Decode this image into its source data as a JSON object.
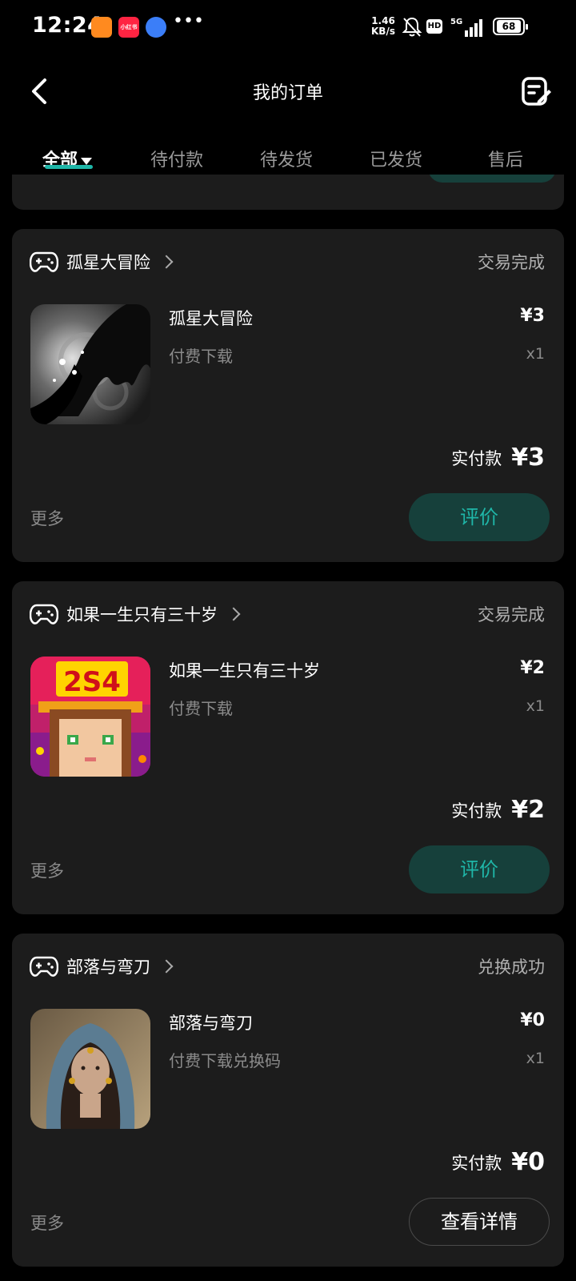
{
  "status_bar": {
    "time": "12:24",
    "app_badge": "小红书",
    "net_speed_value": "1.46",
    "net_speed_unit": "KB/s",
    "hd": "HD",
    "network": "5G",
    "battery": "68"
  },
  "header": {
    "title": "我的订单"
  },
  "tabs": [
    {
      "label": "全部"
    },
    {
      "label": "待付款"
    },
    {
      "label": "待发货"
    },
    {
      "label": "已发货"
    },
    {
      "label": "售后"
    }
  ],
  "orders": [
    {
      "store": "孤星大冒险",
      "status": "交易完成",
      "item_name": "孤星大冒险",
      "item_type": "付费下载",
      "price": "¥3",
      "qty": "x1",
      "paid_label": "实付款",
      "paid_amount": "¥3",
      "more": "更多",
      "action": "评价"
    },
    {
      "store": "如果一生只有三十岁",
      "status": "交易完成",
      "item_name": "如果一生只有三十岁",
      "item_type": "付费下载",
      "price": "¥2",
      "qty": "x1",
      "paid_label": "实付款",
      "paid_amount": "¥2",
      "more": "更多",
      "action": "评价",
      "thumb_text": "2S4"
    },
    {
      "store": "部落与弯刀",
      "status": "兑换成功",
      "item_name": "部落与弯刀",
      "item_type": "付费下载兑换码",
      "price": "¥0",
      "qty": "x1",
      "paid_label": "实付款",
      "paid_amount": "¥0",
      "more": "更多",
      "action": "查看详情"
    }
  ],
  "colors": {
    "accent": "#1fb6a8",
    "button_bg": "#16403b",
    "card_bg": "#1c1c1c"
  }
}
